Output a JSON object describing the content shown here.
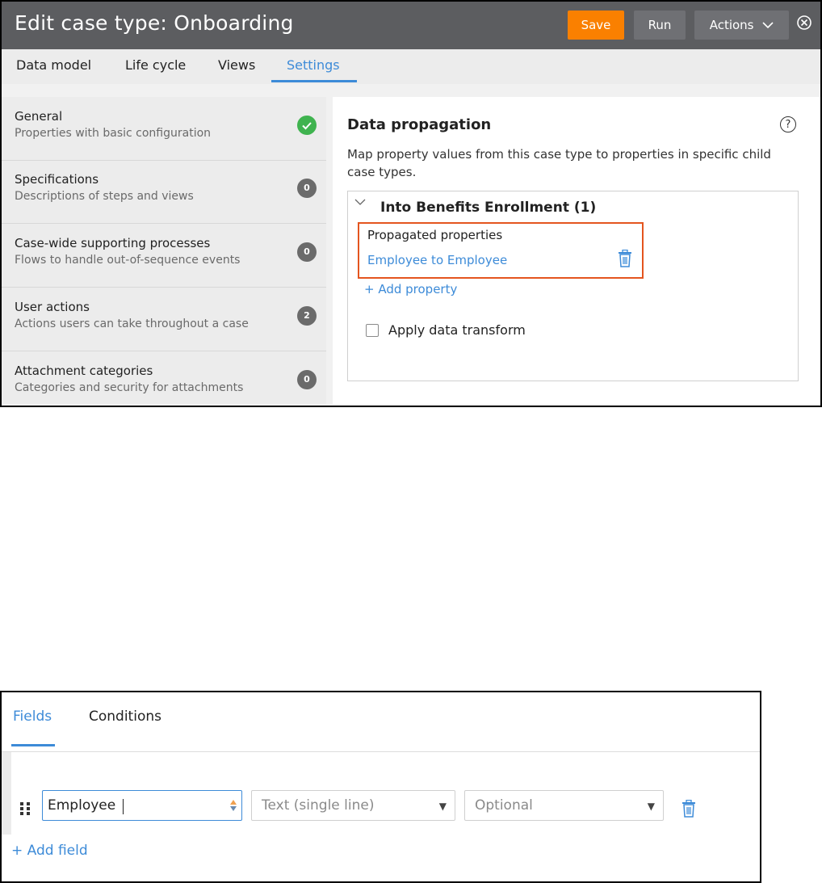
{
  "header": {
    "title": "Edit case type: Onboarding",
    "save_label": "Save",
    "run_label": "Run",
    "actions_label": "Actions",
    "accent_color": "#fa8000"
  },
  "tabs": [
    {
      "label": "Data model"
    },
    {
      "label": "Life cycle"
    },
    {
      "label": "Views"
    },
    {
      "label": "Settings",
      "active": true
    }
  ],
  "sidebar": {
    "items": [
      {
        "label": "General",
        "description": "Properties with basic configuration",
        "status": "check-icon"
      },
      {
        "label": "Specifications",
        "description": "Descriptions of steps and views",
        "count": "0"
      },
      {
        "label": "Case-wide supporting processes",
        "description": "Flows to handle out-of-sequence events",
        "count": "0"
      },
      {
        "label": "User actions",
        "description": "Actions users can take throughout a case",
        "count": "2"
      },
      {
        "label": "Attachment categories",
        "description": "Categories and security for attachments",
        "count": "0"
      }
    ]
  },
  "content": {
    "title": "Data propagation",
    "description": "Map property values from this case type to properties in specific child case types.",
    "group": {
      "title": "Into Benefits Enrollment (1)",
      "properties_heading": "Propagated properties",
      "property_link": "Employee to Employee",
      "add_property": "+ Add property",
      "apply_transform_label": "Apply data transform"
    }
  },
  "fields_panel": {
    "tabs": [
      {
        "label": "Fields",
        "active": true
      },
      {
        "label": "Conditions"
      }
    ],
    "field": {
      "name_value": "Employee",
      "type_value": "Text (single line)",
      "required_value": "Optional"
    },
    "add_field": "+ Add field"
  }
}
